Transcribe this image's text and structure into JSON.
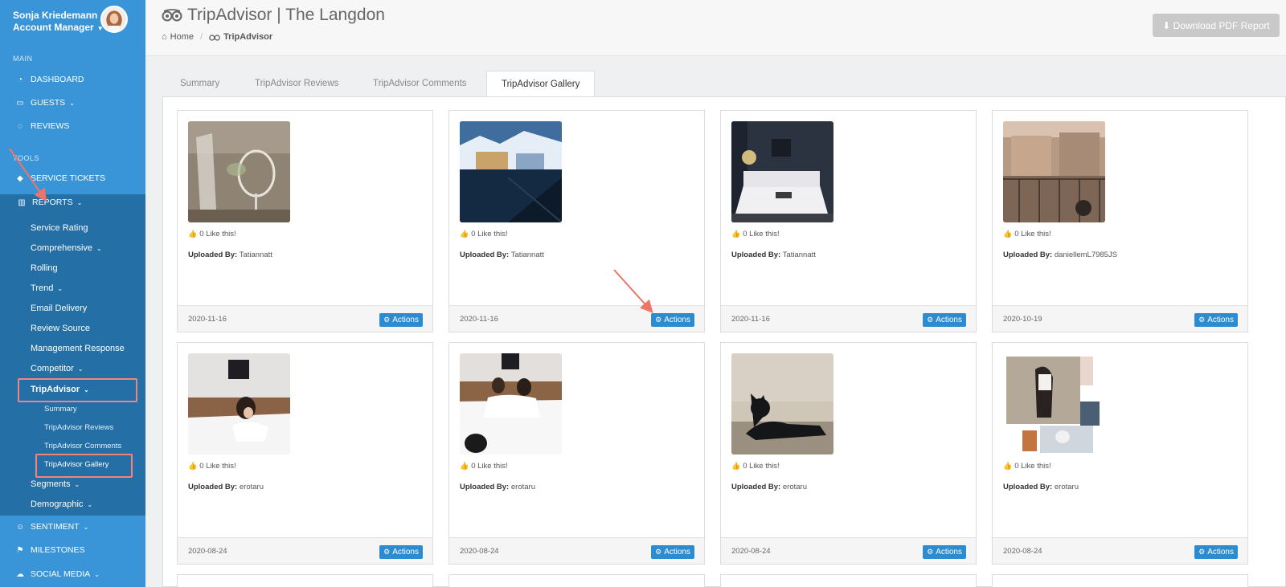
{
  "user": {
    "name": "Sonja Kriedemann",
    "role": "Account Manager"
  },
  "sidebar": {
    "main_title": "MAIN",
    "tools_title": "TOOLS",
    "main_items": [
      {
        "label": "DASHBOARD",
        "icon": "dashboard-icon"
      },
      {
        "label": "GUESTS",
        "icon": "bed-icon"
      },
      {
        "label": "REVIEWS",
        "icon": "comments-icon"
      }
    ],
    "tools_items": [
      {
        "label": "SERVICE TICKETS",
        "icon": "tags-icon"
      },
      {
        "label": "REPORTS",
        "icon": "bar-chart-icon"
      }
    ],
    "report_items": [
      {
        "label": "Service Rating"
      },
      {
        "label": "Comprehensive"
      },
      {
        "label": "Rolling"
      },
      {
        "label": "Trend"
      },
      {
        "label": "Email Delivery"
      },
      {
        "label": "Review Source"
      },
      {
        "label": "Management Response"
      },
      {
        "label": "Competitor"
      },
      {
        "label": "TripAdvisor"
      }
    ],
    "tripadvisor_items": [
      {
        "label": "Summary"
      },
      {
        "label": "TripAdvisor Reviews"
      },
      {
        "label": "TripAdvisor Comments"
      },
      {
        "label": "TripAdvisor Gallery"
      }
    ],
    "more_report_items": [
      {
        "label": "Segments"
      },
      {
        "label": "Demographic"
      }
    ],
    "bottom_items": [
      {
        "label": "SENTIMENT",
        "icon": "smile-icon"
      },
      {
        "label": "MILESTONES",
        "icon": "flag-icon"
      },
      {
        "label": "SOCIAL MEDIA",
        "icon": "cloud-icon"
      }
    ]
  },
  "header": {
    "title": "TripAdvisor | The Langdon",
    "breadcrumb_home": "Home",
    "breadcrumb_current": "TripAdvisor",
    "pdf_button": "Download PDF Report"
  },
  "tabs": [
    {
      "label": "Summary"
    },
    {
      "label": "TripAdvisor Reviews"
    },
    {
      "label": "TripAdvisor Comments"
    },
    {
      "label": "TripAdvisor Gallery"
    }
  ],
  "gallery": {
    "likes_suffix": "Like this!",
    "uploaded_by_label": "Uploaded By:",
    "actions_label": "Actions",
    "cards": [
      {
        "likes": "0",
        "uploader": "Tatiannatt",
        "date": "2020-11-16"
      },
      {
        "likes": "0",
        "uploader": "Tatiannatt",
        "date": "2020-11-16"
      },
      {
        "likes": "0",
        "uploader": "Tatiannatt",
        "date": "2020-11-16"
      },
      {
        "likes": "0",
        "uploader": "daniellemL7985JS",
        "date": "2020-10-19"
      },
      {
        "likes": "0",
        "uploader": "erotaru",
        "date": "2020-08-24"
      },
      {
        "likes": "0",
        "uploader": "erotaru",
        "date": "2020-08-24"
      },
      {
        "likes": "0",
        "uploader": "erotaru",
        "date": "2020-08-24"
      },
      {
        "likes": "0",
        "uploader": "erotaru",
        "date": "2020-08-24"
      }
    ]
  }
}
